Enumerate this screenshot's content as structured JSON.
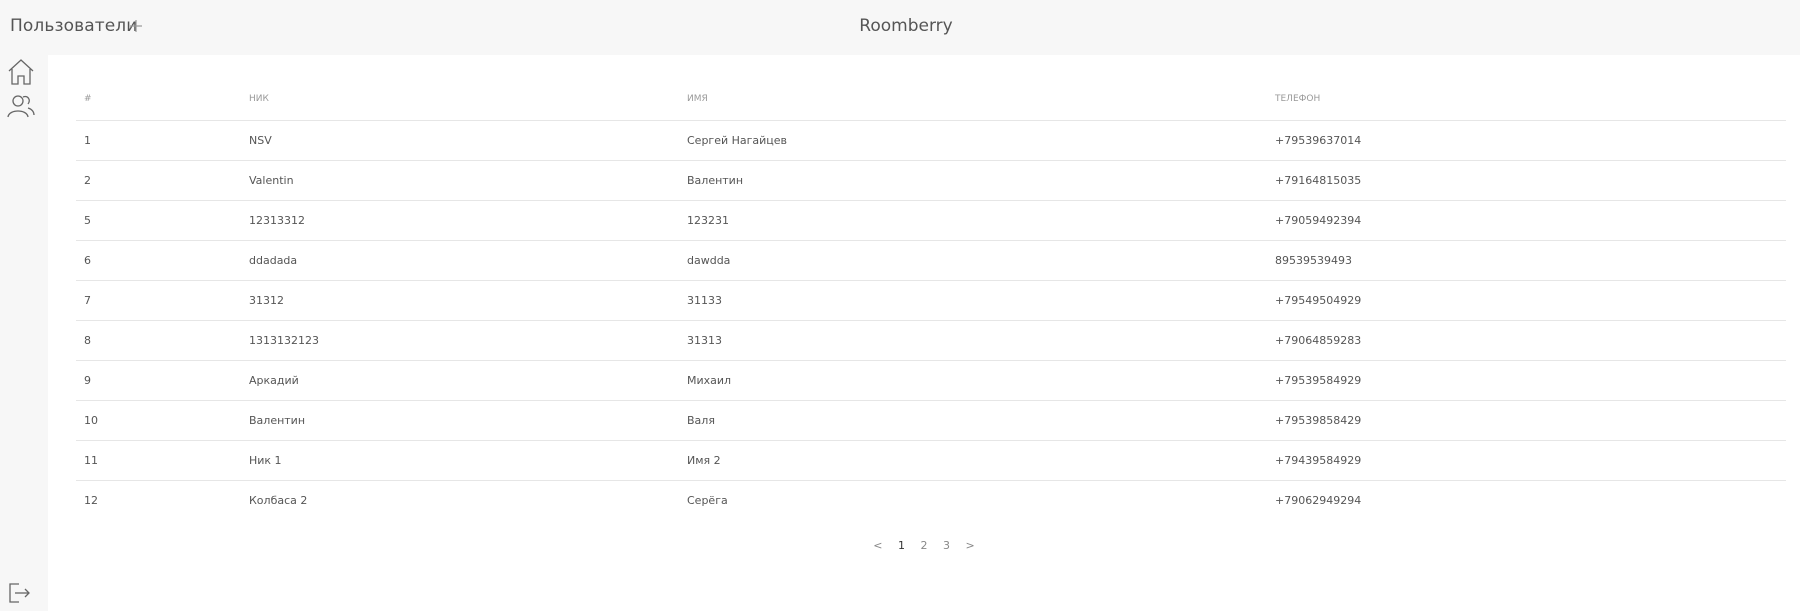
{
  "header": {
    "page_title": "Пользователи",
    "app_title": "Roomberry"
  },
  "icons": {
    "add": "plus-icon",
    "home": "home-icon",
    "users": "users-icon",
    "logout": "logout-icon"
  },
  "table": {
    "columns": [
      "#",
      "Ник",
      "Имя",
      "Телефон"
    ],
    "rows": [
      {
        "id": "1",
        "nick": "NSV",
        "name": "Сергей Нагайцев",
        "phone": "+79539637014"
      },
      {
        "id": "2",
        "nick": "Valentin",
        "name": "Валентин",
        "phone": "+79164815035"
      },
      {
        "id": "5",
        "nick": "12313312",
        "name": "123231",
        "phone": "+79059492394"
      },
      {
        "id": "6",
        "nick": "ddadada",
        "name": "dawdda",
        "phone": "89539539493"
      },
      {
        "id": "7",
        "nick": "31312",
        "name": "31133",
        "phone": "+79549504929"
      },
      {
        "id": "8",
        "nick": "1313132123",
        "name": "31313",
        "phone": "+79064859283"
      },
      {
        "id": "9",
        "nick": "Аркадий",
        "name": "Михаил",
        "phone": "+79539584929"
      },
      {
        "id": "10",
        "nick": "Валентин",
        "name": "Валя",
        "phone": "+79539858429"
      },
      {
        "id": "11",
        "nick": "Ник 1",
        "name": "Имя 2",
        "phone": "+79439584929"
      },
      {
        "id": "12",
        "nick": "Колбаса 2",
        "name": "Серёга",
        "phone": "+79062949294"
      }
    ]
  },
  "pagination": {
    "prev": "<",
    "pages": [
      "1",
      "2",
      "3"
    ],
    "current": "1",
    "next": ">"
  },
  "colors": {
    "background": "#f7f7f7",
    "content": "#ffffff",
    "text": "#555555",
    "divider": "#e6e6e6"
  }
}
